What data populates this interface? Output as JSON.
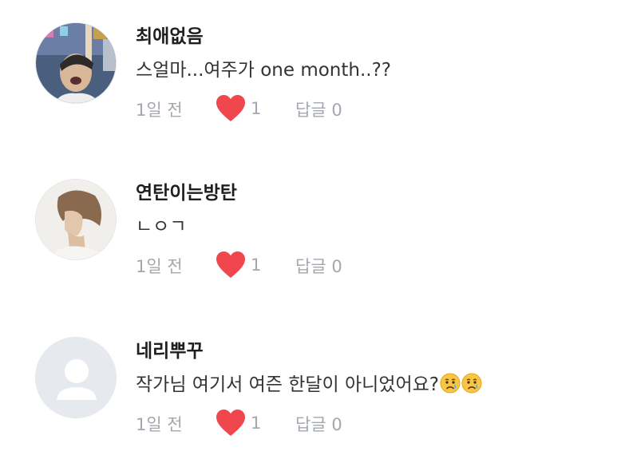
{
  "comments": [
    {
      "username": "최애없음",
      "text": "스얼마...여주가 one month..??",
      "time": "1일 전",
      "likes": "1",
      "reply_label": "답글 0"
    },
    {
      "username": "연탄이는방탄",
      "text": "ㄴㅇㄱ",
      "time": "1일 전",
      "likes": "1",
      "reply_label": "답글 0"
    },
    {
      "username": "네리뿌꾸",
      "text": "작가님 여기서 여즌 한달이 아니었어요?",
      "text_emoji": [
        "crying-face",
        "crying-face"
      ],
      "time": "1일 전",
      "likes": "1",
      "reply_label": "답글 0"
    }
  ],
  "colors": {
    "heart": "#f0474f",
    "meta_text": "#a3a8ae",
    "username": "#1f1f1f",
    "body_text": "#333333",
    "default_avatar_bg": "#e6e9ed",
    "default_avatar_fg": "#ffffff"
  },
  "icons": {
    "like": "heart-icon",
    "default_avatar": "default-user-icon"
  }
}
